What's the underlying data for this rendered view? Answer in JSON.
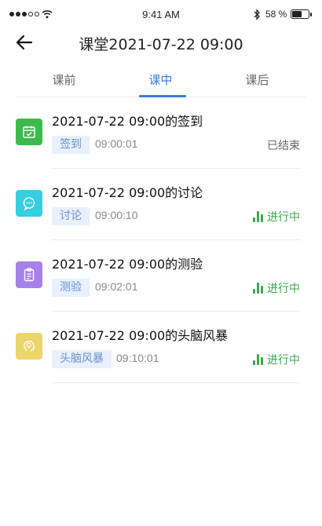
{
  "status_bar": {
    "time": "9:41 AM",
    "battery_text": "58 %",
    "battery_level": 0.58
  },
  "header": {
    "title": "课堂2021-07-22 09:00"
  },
  "tabs": [
    {
      "label": "课前",
      "active": false
    },
    {
      "label": "课中",
      "active": true
    },
    {
      "label": "课后",
      "active": false
    }
  ],
  "items": [
    {
      "title": "2021-07-22 09:00的签到",
      "tag": "签到",
      "time": "09:00:01",
      "status": "已结束",
      "icon": "calendar-check-icon",
      "color": "#3dba4e"
    },
    {
      "title": "2021-07-22 09:00的讨论",
      "tag": "讨论",
      "time": "09:00:10",
      "status": "进行中",
      "icon": "chat-bubble-icon",
      "color": "#35cfdf"
    },
    {
      "title": "2021-07-22 09:00的测验",
      "tag": "测验",
      "time": "09:02:01",
      "status": "进行中",
      "icon": "clipboard-icon",
      "color": "#a582ea"
    },
    {
      "title": "2021-07-22 09:00的头脑风暴",
      "tag": "头脑风暴",
      "time": "09:10:01",
      "status": "进行中",
      "icon": "lightbulb-head-icon",
      "color": "#ecd56a"
    }
  ],
  "colors": {
    "accent": "#3a7fdc",
    "live": "#3aaa4b",
    "tag_bg": "#e8f0fb",
    "tag_text": "#6d8fd0"
  }
}
